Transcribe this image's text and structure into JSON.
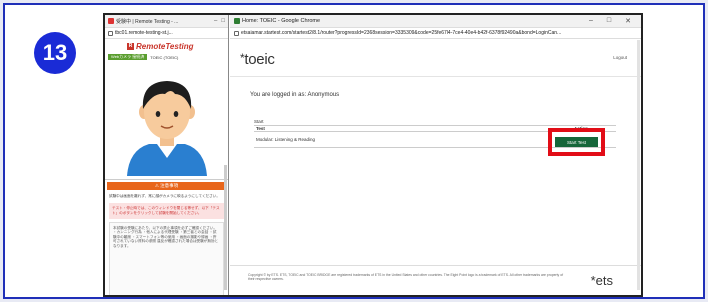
{
  "step": {
    "number": "13"
  },
  "left_window": {
    "tab_title": "受験中 | Remote Testing - ...",
    "url": "tbc01.remote-testing-st.j...",
    "brand": "RemoteTesting",
    "status_pill": "Webカメラ 接続済",
    "status_text": "TOEIC (TOEIC)",
    "alert_label": "注意事項",
    "instructions": "試験中は画面を離れず、常に顔がカメラに映るようにしてください。",
    "warning": "テスト・停止時では、このウィンドウを閉じる等せず、以下「テスト」のボタンをクリックして試験を開始してください。",
    "notes": "本試験の受験にあたり、以下の禁止事項を必ずご確認ください。 ・カンニング行為 ・他人による代理受験 ・第三者との会話 ・試験中の離席 ・スマートフォン等の使用 ・画面の撮影や録画 ・許可されていない資料の参照 違反が確認された場合は受験が無効となります。"
  },
  "right_window": {
    "tab_title": "Home: TOEIC - Google Chrome",
    "url": "etsaiamar.startest.com/startest2/8.1/router?progressId=2368session=3335309&code=25fe67l4-7ce4-40e4-b42f-6378f92490a&bond=LoginCan...",
    "logo": "toeic",
    "logo_mark": "*",
    "logout": "Logout",
    "logged_in": "You are logged in as: Anonymous",
    "table": {
      "start_label": "Start",
      "col_test": "Test",
      "col_action": "Action",
      "rows": [
        {
          "test": "Modular: Listening & Reading",
          "action": "Start Test"
        }
      ]
    },
    "footer": "Copyright © by ETS. ETS, TOEIC and TOEIC BRIDGE are registered trademarks of ETS in the United States and other countries. The Eight Point logo is a trademark of ETS. All other trademarks are property of their respective owners.",
    "ets_logo": "*ets"
  },
  "colors": {
    "step_circle": "#1a2bd6",
    "start_button": "#16663a",
    "highlight_box": "#e20d17",
    "alert_bar": "#e8651a"
  }
}
